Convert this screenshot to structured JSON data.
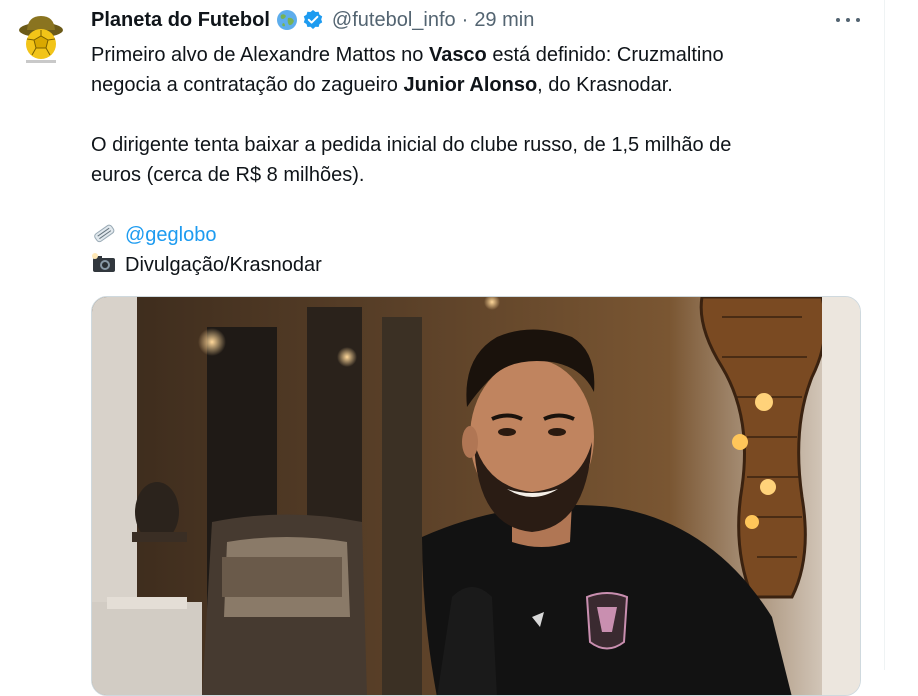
{
  "tweet": {
    "display_name": "Planeta do Futebol",
    "globe_emoji": "globe-emoji",
    "verified_icon": "verified-badge-icon",
    "handle": "@futebol_info",
    "separator": "·",
    "time": "29 min",
    "more_icon": "more-options-icon",
    "body": {
      "line1_a": "Primeiro alvo de Alexandre Mattos no ",
      "line1_bold": "Vasco",
      "line1_b": " está definido: Cruzmaltino",
      "line2_a": "negocia a contratação do zagueiro ",
      "line2_bold": "Junior Alonso",
      "line2_b": ", do Krasnodar.",
      "line3": "O dirigente tenta baixar a pedida inicial do clube russo, de 1,5 milhão de",
      "line4": "euros (cerca de R$ 8 milhões).",
      "source_icon": "newspaper-emoji",
      "source_mention": "@geglobo",
      "photo_icon": "camera-flash-emoji",
      "photo_credit": "Divulgação/Krasnodar"
    },
    "media": {
      "description": "photo"
    }
  },
  "colors": {
    "link": "#1d9bf0",
    "secondary_text": "#536471",
    "primary_text": "#0f1419",
    "verified": "#1d9bf0"
  }
}
